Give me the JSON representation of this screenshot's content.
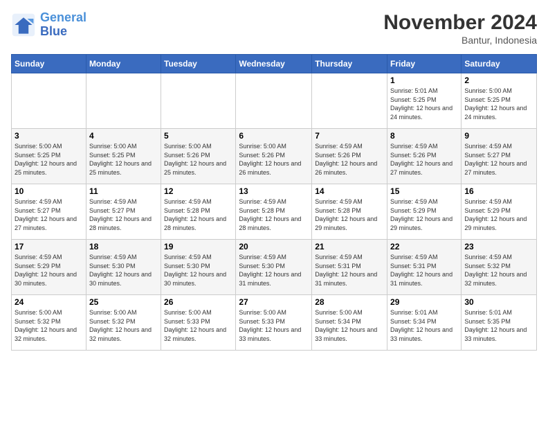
{
  "logo": {
    "line1": "General",
    "line2": "Blue"
  },
  "title": "November 2024",
  "location": "Bantur, Indonesia",
  "weekdays": [
    "Sunday",
    "Monday",
    "Tuesday",
    "Wednesday",
    "Thursday",
    "Friday",
    "Saturday"
  ],
  "weeks": [
    [
      {
        "day": "",
        "info": ""
      },
      {
        "day": "",
        "info": ""
      },
      {
        "day": "",
        "info": ""
      },
      {
        "day": "",
        "info": ""
      },
      {
        "day": "",
        "info": ""
      },
      {
        "day": "1",
        "info": "Sunrise: 5:01 AM\nSunset: 5:25 PM\nDaylight: 12 hours and 24 minutes."
      },
      {
        "day": "2",
        "info": "Sunrise: 5:00 AM\nSunset: 5:25 PM\nDaylight: 12 hours and 24 minutes."
      }
    ],
    [
      {
        "day": "3",
        "info": "Sunrise: 5:00 AM\nSunset: 5:25 PM\nDaylight: 12 hours and 25 minutes."
      },
      {
        "day": "4",
        "info": "Sunrise: 5:00 AM\nSunset: 5:25 PM\nDaylight: 12 hours and 25 minutes."
      },
      {
        "day": "5",
        "info": "Sunrise: 5:00 AM\nSunset: 5:26 PM\nDaylight: 12 hours and 25 minutes."
      },
      {
        "day": "6",
        "info": "Sunrise: 5:00 AM\nSunset: 5:26 PM\nDaylight: 12 hours and 26 minutes."
      },
      {
        "day": "7",
        "info": "Sunrise: 4:59 AM\nSunset: 5:26 PM\nDaylight: 12 hours and 26 minutes."
      },
      {
        "day": "8",
        "info": "Sunrise: 4:59 AM\nSunset: 5:26 PM\nDaylight: 12 hours and 27 minutes."
      },
      {
        "day": "9",
        "info": "Sunrise: 4:59 AM\nSunset: 5:27 PM\nDaylight: 12 hours and 27 minutes."
      }
    ],
    [
      {
        "day": "10",
        "info": "Sunrise: 4:59 AM\nSunset: 5:27 PM\nDaylight: 12 hours and 27 minutes."
      },
      {
        "day": "11",
        "info": "Sunrise: 4:59 AM\nSunset: 5:27 PM\nDaylight: 12 hours and 28 minutes."
      },
      {
        "day": "12",
        "info": "Sunrise: 4:59 AM\nSunset: 5:28 PM\nDaylight: 12 hours and 28 minutes."
      },
      {
        "day": "13",
        "info": "Sunrise: 4:59 AM\nSunset: 5:28 PM\nDaylight: 12 hours and 28 minutes."
      },
      {
        "day": "14",
        "info": "Sunrise: 4:59 AM\nSunset: 5:28 PM\nDaylight: 12 hours and 29 minutes."
      },
      {
        "day": "15",
        "info": "Sunrise: 4:59 AM\nSunset: 5:29 PM\nDaylight: 12 hours and 29 minutes."
      },
      {
        "day": "16",
        "info": "Sunrise: 4:59 AM\nSunset: 5:29 PM\nDaylight: 12 hours and 29 minutes."
      }
    ],
    [
      {
        "day": "17",
        "info": "Sunrise: 4:59 AM\nSunset: 5:29 PM\nDaylight: 12 hours and 30 minutes."
      },
      {
        "day": "18",
        "info": "Sunrise: 4:59 AM\nSunset: 5:30 PM\nDaylight: 12 hours and 30 minutes."
      },
      {
        "day": "19",
        "info": "Sunrise: 4:59 AM\nSunset: 5:30 PM\nDaylight: 12 hours and 30 minutes."
      },
      {
        "day": "20",
        "info": "Sunrise: 4:59 AM\nSunset: 5:30 PM\nDaylight: 12 hours and 31 minutes."
      },
      {
        "day": "21",
        "info": "Sunrise: 4:59 AM\nSunset: 5:31 PM\nDaylight: 12 hours and 31 minutes."
      },
      {
        "day": "22",
        "info": "Sunrise: 4:59 AM\nSunset: 5:31 PM\nDaylight: 12 hours and 31 minutes."
      },
      {
        "day": "23",
        "info": "Sunrise: 4:59 AM\nSunset: 5:32 PM\nDaylight: 12 hours and 32 minutes."
      }
    ],
    [
      {
        "day": "24",
        "info": "Sunrise: 5:00 AM\nSunset: 5:32 PM\nDaylight: 12 hours and 32 minutes."
      },
      {
        "day": "25",
        "info": "Sunrise: 5:00 AM\nSunset: 5:32 PM\nDaylight: 12 hours and 32 minutes."
      },
      {
        "day": "26",
        "info": "Sunrise: 5:00 AM\nSunset: 5:33 PM\nDaylight: 12 hours and 32 minutes."
      },
      {
        "day": "27",
        "info": "Sunrise: 5:00 AM\nSunset: 5:33 PM\nDaylight: 12 hours and 33 minutes."
      },
      {
        "day": "28",
        "info": "Sunrise: 5:00 AM\nSunset: 5:34 PM\nDaylight: 12 hours and 33 minutes."
      },
      {
        "day": "29",
        "info": "Sunrise: 5:01 AM\nSunset: 5:34 PM\nDaylight: 12 hours and 33 minutes."
      },
      {
        "day": "30",
        "info": "Sunrise: 5:01 AM\nSunset: 5:35 PM\nDaylight: 12 hours and 33 minutes."
      }
    ]
  ]
}
